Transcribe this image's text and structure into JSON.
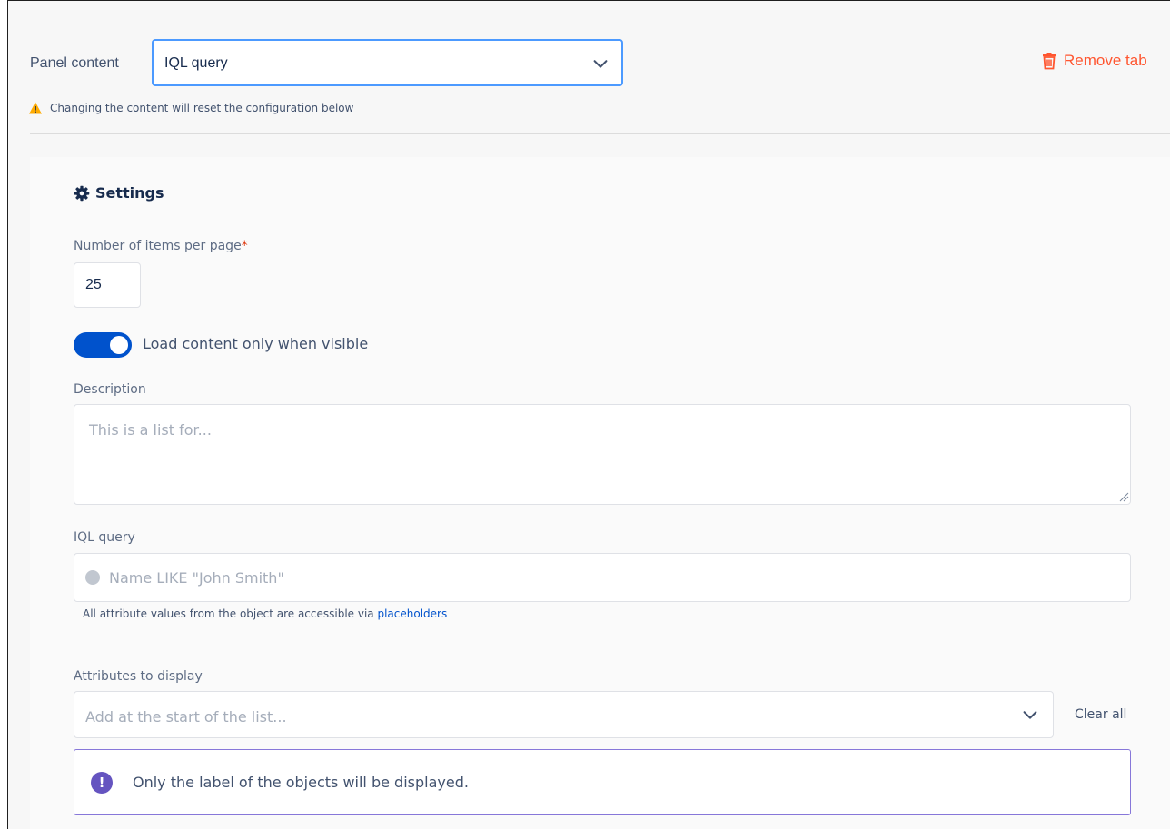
{
  "panel": {
    "label": "Panel content",
    "selected": "IQL query",
    "remove_tab": "Remove tab",
    "warning": "Changing the content will reset the configuration below"
  },
  "settings": {
    "title": "Settings",
    "items_per_page_label": "Number of items per page",
    "required_mark": "*",
    "items_per_page_value": "25",
    "toggle_label": "Load content only when visible",
    "toggle_on": true,
    "description_label": "Description",
    "description_placeholder": "This is a list for...",
    "iql_label": "IQL query",
    "iql_placeholder": "Name LIKE \"John Smith\"",
    "helper_text": "All attribute values from the object are accessible via ",
    "helper_link": "placeholders",
    "attributes_label": "Attributes to display",
    "attributes_placeholder": "Add at the start of the list...",
    "clear_all": "Clear all",
    "info_message": "Only the label of the objects will be displayed."
  },
  "colors": {
    "accent": "#0052cc",
    "danger": "#ff5630",
    "warning": "#ffab00",
    "info": "#6554c0"
  }
}
